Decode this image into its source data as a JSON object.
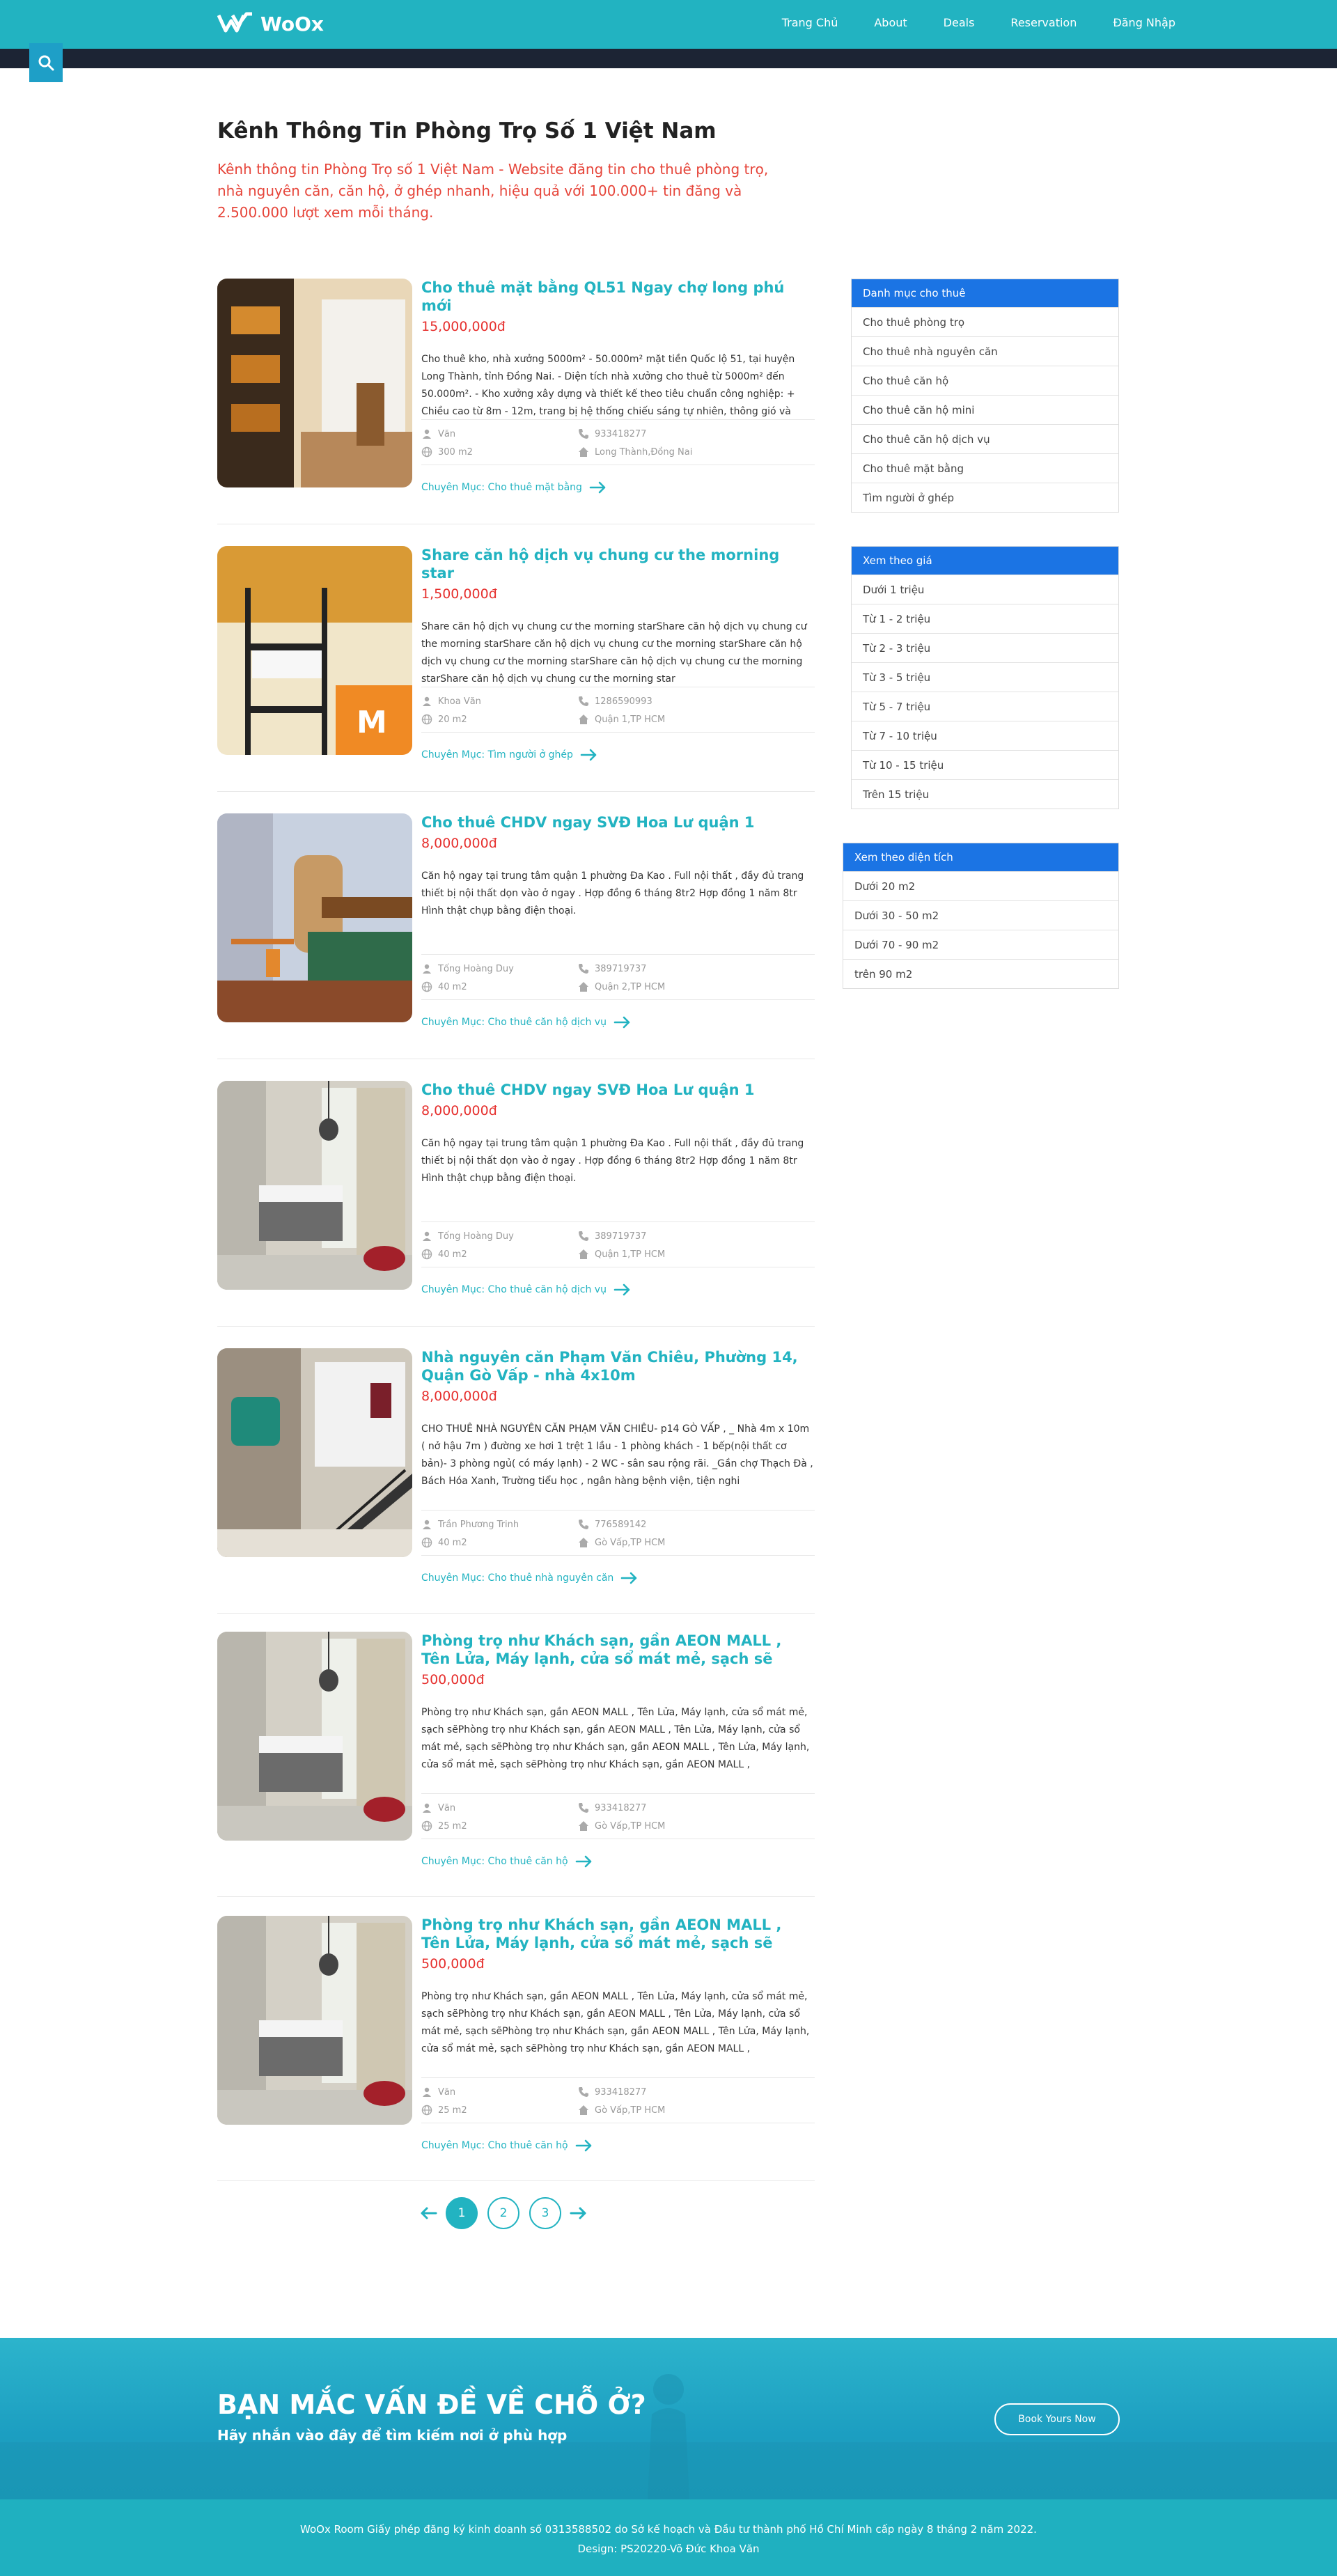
{
  "header": {
    "brand": "WoOx",
    "nav": [
      "Trang Chủ",
      "About",
      "Deals",
      "Reservation",
      "Đăng Nhập"
    ],
    "accent": "#22b3c1"
  },
  "intro": {
    "title": "Kênh Thông Tin Phòng Trọ Số 1 Việt Nam",
    "description": "Kênh thông tin Phòng Trọ số 1 Việt Nam - Website đăng tin cho thuê phòng trọ, nhà nguyên căn, căn hộ, ở ghép nhanh, hiệu quả với 100.000+ tin đăng và 2.500.000 lượt xem mỗi tháng."
  },
  "posts": [
    {
      "title": "Cho thuê mặt bằng QL51 Ngay chợ long phú mới",
      "price": "15,000,000đ",
      "desc": "Cho thuê kho, nhà xưởng 5000m² - 50.000m² mặt tiền Quốc lộ 51, tại huyện Long Thành, tỉnh Đồng Nai. - Diện tích nhà xưởng cho thuê từ 5000m² đến 50.000m². - Kho xưởng xây dựng và thiết kế theo tiêu chuẩn công nghiệp: + Chiều cao từ 8m - 12m, trang bị hệ thống chiếu sáng tự nhiên, thông gió và",
      "owner": "Văn",
      "phone": "933418277",
      "area": "300 m2",
      "address": "Long Thành,Đồng Nai",
      "category": "Chuyên Mục: Cho thuê mặt bằng",
      "image": "room-interior-wooden-shelves"
    },
    {
      "title": "Share căn hộ dịch vụ chung cư the morning star",
      "price": "1,500,000đ",
      "desc": "Share căn hộ dịch vụ chung cư the morning starShare căn hộ dịch vụ chung cư the morning starShare căn hộ dịch vụ chung cư the morning starShare căn hộ dịch vụ chung cư the morning starShare căn hộ dịch vụ chung cư the morning starShare căn hộ dịch vụ chung cư the morning star",
      "owner": "Khoa Văn",
      "phone": "1286590993",
      "area": "20 m2",
      "address": "Quận 1,TP HCM",
      "category": "Chuyên Mục: Tìm người ở ghép",
      "image": "bunk-bed-room"
    },
    {
      "title": "Cho thuê CHDV ngay SVĐ Hoa Lư quận 1",
      "price": "8,000,000đ",
      "desc": "Căn hộ ngay tại trung tâm quận 1 phường Đa Kao . Full nội thất , đầy đủ trang thiết bị nội thất dọn vào ở ngay . Hợp đồng 6 tháng 8tr2 Hợp đồng 1 năm 8tr Hình thật chụp bằng điện thoại.",
      "owner": "Tống Hoàng Duy",
      "phone": "389719737",
      "area": "40 m2",
      "address": "Quận 2,TP HCM",
      "category": "Chuyên Mục: Cho thuê căn hộ dịch vụ",
      "image": "bedroom-desk-green-bed"
    },
    {
      "title": "Cho thuê CHDV ngay SVĐ Hoa Lư quận 1",
      "price": "8,000,000đ",
      "desc": "Căn hộ ngay tại trung tâm quận 1 phường Đa Kao . Full nội thất , đầy đủ trang thiết bị nội thất dọn vào ở ngay . Hợp đồng 6 tháng 8tr2 Hợp đồng 1 năm 8tr Hình thật chụp bằng điện thoại.",
      "owner": "Tống Hoàng Duy",
      "phone": "389719737",
      "area": "40 m2",
      "address": "Quận 1,TP HCM",
      "category": "Chuyên Mục: Cho thuê căn hộ dịch vụ",
      "image": "bedroom-window-curtain"
    },
    {
      "title": "Nhà nguyên căn Phạm Văn Chiêu, Phường 14, Quận Gò Vấp - nhà 4x10m",
      "price": "8,000,000đ",
      "desc": "CHO THUÊ NHÀ NGUYÊN CĂN PHẠM VĂN CHIÊU- p14 GÒ VẤP , _ Nhà 4m x 10m ( nở hậu 7m ) đường xe hơi 1 trệt 1 lầu - 1 phòng khách - 1 bếp(nội thất cơ bản)- 3 phòng ngủ( có máy lạnh) - 2 WC - sân sau rộng rãi. _Gần chợ Thạch Đà , Bách Hóa Xanh, Trường tiểu học , ngân hàng bệnh viện, tiện nghi",
      "owner": "Trần Phương Trinh",
      "phone": "776589142",
      "area": "40 m2",
      "address": "Gò Vấp,TP HCM",
      "category": "Chuyên Mục: Cho thuê nhà nguyên căn",
      "image": "house-interior-staircase"
    },
    {
      "title": "Phòng trọ như Khách sạn, gần AEON MALL , Tên Lửa, Máy lạnh, cửa sổ mát mẻ, sạch sẽ",
      "price": "500,000đ",
      "desc": "Phòng trọ như Khách sạn, gần AEON MALL , Tên Lửa, Máy lạnh, cửa sổ mát mẻ, sạch sẽPhòng trọ như Khách sạn, gần AEON MALL , Tên Lửa, Máy lạnh, cửa sổ mát mẻ, sạch sẽPhòng trọ như Khách sạn, gần AEON MALL , Tên Lửa, Máy lạnh, cửa sổ mát mẻ, sạch sẽPhòng trọ như Khách sạn, gần AEON MALL ,",
      "owner": "Văn",
      "phone": "933418277",
      "area": "25 m2",
      "address": "Gò Vấp,TP HCM",
      "category": "Chuyên Mục: Cho thuê căn hộ",
      "image": "bedroom-window-curtain"
    },
    {
      "title": "Phòng trọ như Khách sạn, gần AEON MALL , Tên Lửa, Máy lạnh, cửa sổ mát mẻ, sạch sẽ",
      "price": "500,000đ",
      "desc": "Phòng trọ như Khách sạn, gần AEON MALL , Tên Lửa, Máy lạnh, cửa sổ mát mẻ, sạch sẽPhòng trọ như Khách sạn, gần AEON MALL , Tên Lửa, Máy lạnh, cửa sổ mát mẻ, sạch sẽPhòng trọ như Khách sạn, gần AEON MALL , Tên Lửa, Máy lạnh, cửa sổ mát mẻ, sạch sẽPhòng trọ như Khách sạn, gần AEON MALL ,",
      "owner": "Văn",
      "phone": "933418277",
      "area": "25 m2",
      "address": "Gò Vấp,TP HCM",
      "category": "Chuyên Mục: Cho thuê căn hộ",
      "image": "bedroom-window-curtain"
    }
  ],
  "sidebar": {
    "categories": {
      "title": "Danh mục cho thuê",
      "items": [
        "Cho thuê phòng trọ",
        "Cho thuê nhà nguyên căn",
        "Cho thuê căn hộ",
        "Cho thuê căn hộ mini",
        "Cho thuê căn hộ dịch vụ",
        "Cho thuê mặt bằng",
        "Tìm người ở ghép"
      ]
    },
    "price": {
      "title": "Xem theo giá",
      "items": [
        "Dưới 1 triệu",
        "Từ 1 - 2 triệu",
        "Từ 2 - 3 triệu",
        "Từ 3 - 5 triệu",
        "Từ 5 - 7 triệu",
        "Từ 7 - 10 triệu",
        "Từ 10 - 15 triệu",
        "Trên 15 triệu"
      ]
    },
    "area": {
      "title": "Xem theo diện tích",
      "items": [
        "Dưới 20 m2",
        "Dưới 30 - 50 m2",
        "Dưới 70 - 90 m2",
        "trên 90 m2"
      ]
    }
  },
  "pagination": {
    "pages": [
      "1",
      "2",
      "3"
    ],
    "current": "1"
  },
  "cta": {
    "heading": "BẠN MẮC VẤN ĐỀ VỀ CHỖ Ở?",
    "subheading": "Hãy nhắn vào đây để tìm kiếm nơi ở phù hợp",
    "button": "Book Yours Now"
  },
  "footer": {
    "line1": "WoOx Room Giấy phép đăng ký kinh doanh số 0313588502 do Sở kế hoạch và Đầu tư thành phố Hồ Chí Minh cấp ngày 8 tháng 2 năm 2022.",
    "line2": "Design: PS20220-Võ Đức Khoa Văn"
  }
}
